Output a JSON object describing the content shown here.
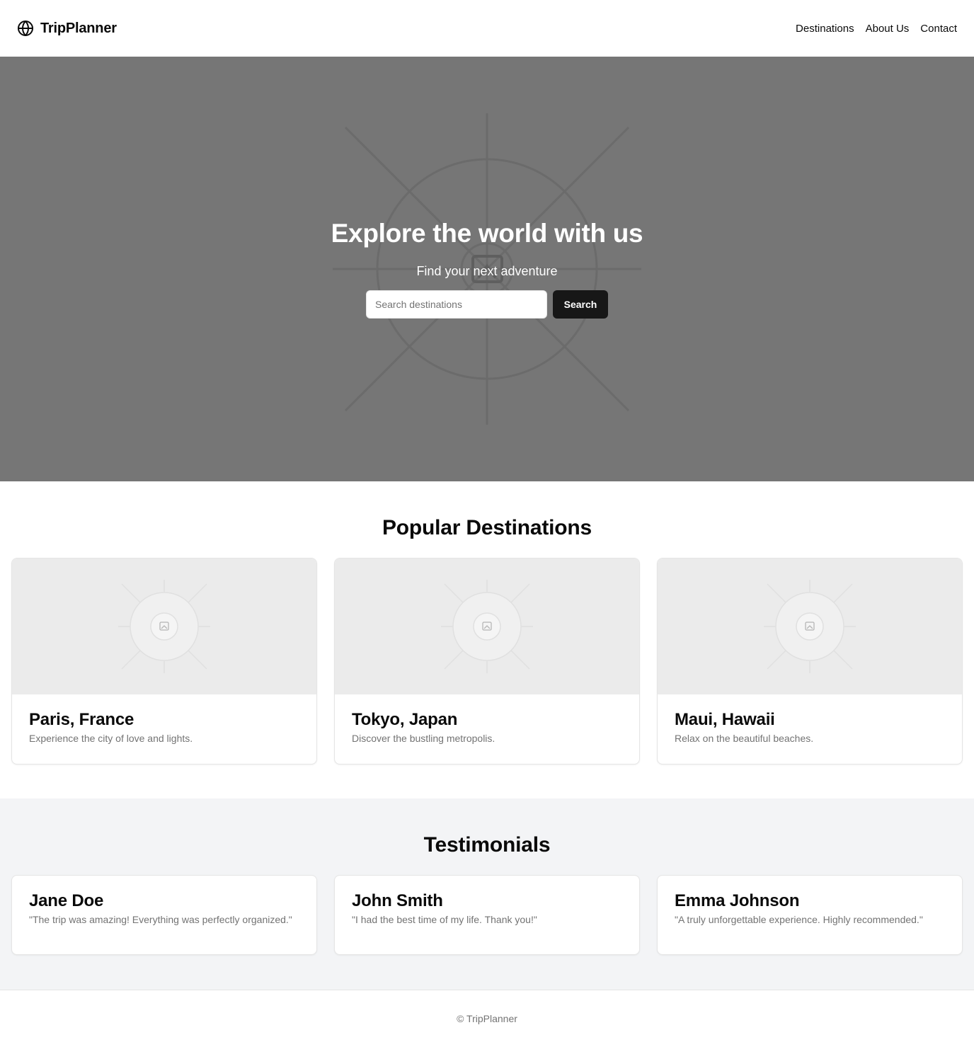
{
  "header": {
    "brand_name": "TripPlanner",
    "brand_icon": "globe-icon",
    "nav": [
      "Destinations",
      "About Us",
      "Contact"
    ]
  },
  "hero": {
    "title": "Explore the world with us",
    "subtitle": "Find your next adventure",
    "search_placeholder": "Search destinations",
    "search_value": "",
    "search_button": "Search",
    "background_icon": "image-placeholder-icon"
  },
  "destinations": {
    "title": "Popular Destinations",
    "items": [
      {
        "name": "Paris, France",
        "description": "Experience the city of love and lights."
      },
      {
        "name": "Tokyo, Japan",
        "description": "Discover the bustling metropolis."
      },
      {
        "name": "Maui, Hawaii",
        "description": "Relax on the beautiful beaches."
      }
    ]
  },
  "testimonials": {
    "title": "Testimonials",
    "items": [
      {
        "name": "Jane Doe",
        "quote": "\"The trip was amazing! Everything was perfectly organized.\""
      },
      {
        "name": "John Smith",
        "quote": "\"I had the best time of my life. Thank you!\""
      },
      {
        "name": "Emma Johnson",
        "quote": "\"A truly unforgettable experience. Highly recommended.\""
      }
    ]
  },
  "footer": {
    "text": "© TripPlanner"
  },
  "colors": {
    "hero_bg": "#767676",
    "button_bg": "#171717",
    "muted_text": "#737373",
    "card_image_bg": "#ebebeb",
    "testimonials_bg": "#f3f4f6"
  }
}
